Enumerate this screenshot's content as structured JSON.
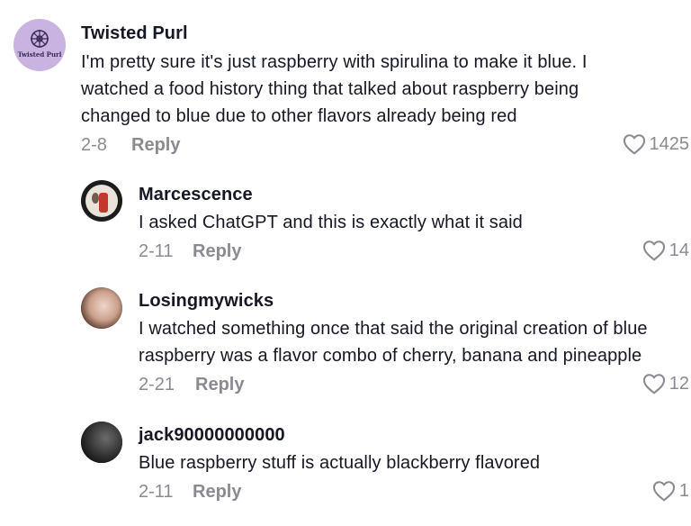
{
  "comments": [
    {
      "username": "Twisted Purl",
      "avatar_text": "Twisted Purl",
      "lines": [
        "I'm pretty sure it's just raspberry with spirulina to make it blue. I",
        "watched a food history thing that talked about raspberry being",
        "changed to blue due to other flavors already being red"
      ],
      "date": "2-8",
      "reply_label": "Reply",
      "likes": "1425"
    },
    {
      "username": "Marcescence",
      "lines": [
        "I asked ChatGPT and this is exactly what it said"
      ],
      "date": "2-11",
      "reply_label": "Reply",
      "likes": "14"
    },
    {
      "username": "Losingmywicks",
      "lines": [
        "I watched something once that said the original creation of blue",
        "raspberry was a flavor combo of cherry, banana and pineapple"
      ],
      "date": "2-21",
      "reply_label": "Reply",
      "likes": "12"
    },
    {
      "username": "jack90000000000",
      "lines": [
        "Blue raspberry stuff is actually blackberry flavored"
      ],
      "date": "2-11",
      "reply_label": "Reply",
      "likes": "1"
    }
  ],
  "colors": {
    "text": "#161823",
    "muted": "#8a8b91",
    "avatar_purple": "#c9b3e0"
  },
  "icons": {
    "like": "heart-outline-icon",
    "logo": "wheel-logo-icon"
  }
}
